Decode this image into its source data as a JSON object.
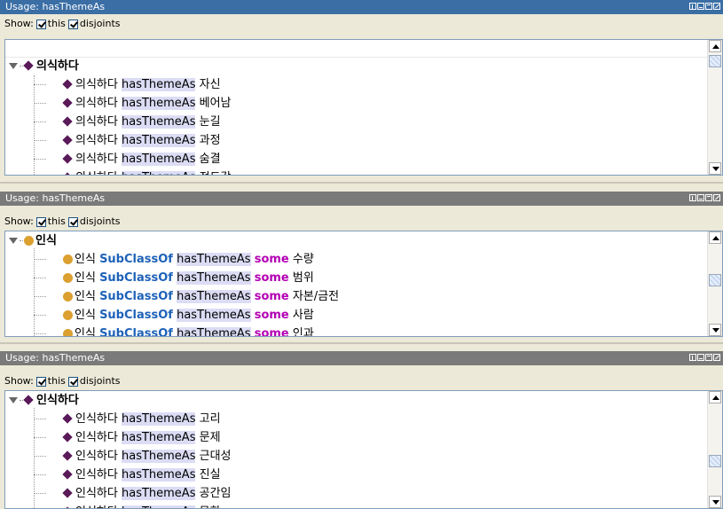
{
  "panels": [
    {
      "title": "Usage: hasThemeAs",
      "show_label": "Show:",
      "this_label": "this",
      "disjoints_label": "disjoints",
      "root": "의식하다",
      "root_icon": "diamond-icon",
      "rows": [
        {
          "icon": "diamond-icon",
          "subject": "의식하다",
          "property": "hasThemeAs",
          "object": "자신"
        },
        {
          "icon": "diamond-icon",
          "subject": "의식하다",
          "property": "hasThemeAs",
          "object": "베어남"
        },
        {
          "icon": "diamond-icon",
          "subject": "의식하다",
          "property": "hasThemeAs",
          "object": "눈길"
        },
        {
          "icon": "diamond-icon",
          "subject": "의식하다",
          "property": "hasThemeAs",
          "object": "과정"
        },
        {
          "icon": "diamond-icon",
          "subject": "의식하다",
          "property": "hasThemeAs",
          "object": "숨결"
        },
        {
          "icon": "diamond-icon",
          "subject": "의식하다",
          "property": "hasThemeAs",
          "object": "정도감"
        }
      ]
    },
    {
      "title": "Usage: hasThemeAs",
      "show_label": "Show:",
      "this_label": "this",
      "disjoints_label": "disjoints",
      "root": "인식",
      "root_icon": "circle-icon",
      "keyword1": "SubClassOf",
      "keyword2": "some",
      "rows": [
        {
          "icon": "circle-icon",
          "subject": "인식",
          "property": "hasThemeAs",
          "object": "수량"
        },
        {
          "icon": "circle-icon",
          "subject": "인식",
          "property": "hasThemeAs",
          "object": "범위"
        },
        {
          "icon": "circle-icon",
          "subject": "인식",
          "property": "hasThemeAs",
          "object": "자본/금전"
        },
        {
          "icon": "circle-icon",
          "subject": "인식",
          "property": "hasThemeAs",
          "object": "사람"
        },
        {
          "icon": "circle-icon",
          "subject": "인식",
          "property": "hasThemeAs",
          "object": "인과"
        }
      ]
    },
    {
      "title": "Usage: hasThemeAs",
      "show_label": "Show:",
      "this_label": "this",
      "disjoints_label": "disjoints",
      "root": "인식하다",
      "root_icon": "diamond-icon",
      "rows": [
        {
          "icon": "diamond-icon",
          "subject": "인식하다",
          "property": "hasThemeAs",
          "object": "고리"
        },
        {
          "icon": "diamond-icon",
          "subject": "인식하다",
          "property": "hasThemeAs",
          "object": "문제"
        },
        {
          "icon": "diamond-icon",
          "subject": "인식하다",
          "property": "hasThemeAs",
          "object": "근대성"
        },
        {
          "icon": "diamond-icon",
          "subject": "인식하다",
          "property": "hasThemeAs",
          "object": "진실"
        },
        {
          "icon": "diamond-icon",
          "subject": "인식하다",
          "property": "hasThemeAs",
          "object": "공간임"
        },
        {
          "icon": "diamond-icon",
          "subject": "인식하다",
          "property": "hasThemeAs",
          "object": "무한"
        }
      ]
    }
  ],
  "colors": {
    "active_title": "#3a6ea5",
    "inactive_title": "#7a7a7a",
    "highlight": "#dcdcf5",
    "keyword_blue": "#1e62b8",
    "keyword_magenta": "#b400b4"
  }
}
